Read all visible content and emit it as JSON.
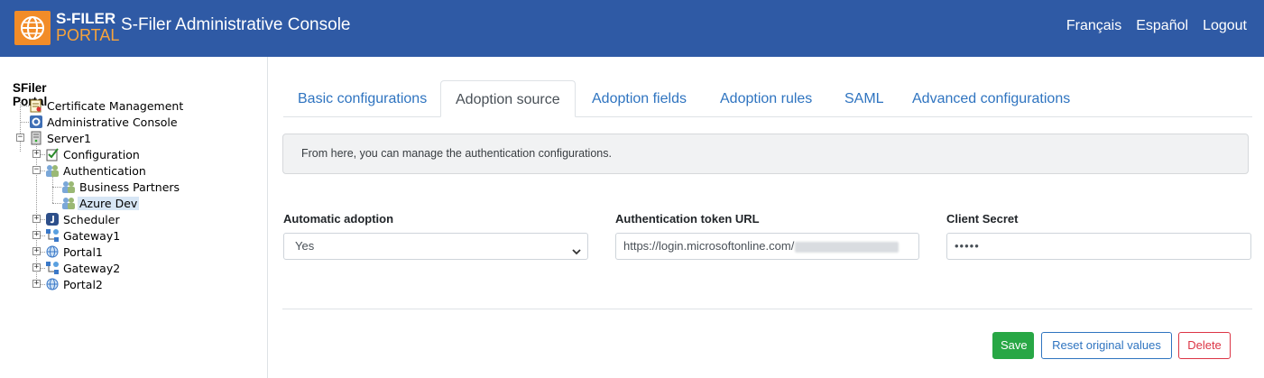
{
  "header": {
    "logo_line1": "S-FILER",
    "logo_line2": "PORTAL",
    "title": "S-Filer Administrative Console",
    "links": [
      "Français",
      "Español",
      "Logout"
    ]
  },
  "tree": {
    "root": "SFiler Portal",
    "certificate_management": "Certificate Management",
    "administrative_console": "Administrative Console",
    "server1": "Server1",
    "configuration": "Configuration",
    "authentication": "Authentication",
    "business_partners": "Business Partners",
    "azure_dev": "Azure Dev",
    "scheduler": "Scheduler",
    "gateway1": "Gateway1",
    "portal1": "Portal1",
    "gateway2": "Gateway2",
    "portal2": "Portal2"
  },
  "tabs": [
    "Basic configurations",
    "Adoption source",
    "Adoption fields",
    "Adoption rules",
    "SAML",
    "Advanced configurations"
  ],
  "active_tab": "Adoption source",
  "info_text": "From here, you can manage the authentication configurations.",
  "form": {
    "automatic_adoption_label": "Automatic adoption",
    "automatic_adoption_value": "Yes",
    "token_url_label": "Authentication token URL",
    "token_url_value": "https://login.microsoftonline.com/",
    "client_secret_label": "Client Secret",
    "client_secret_value": "•••••"
  },
  "buttons": {
    "save": "Save",
    "reset": "Reset original values",
    "delete": "Delete"
  },
  "colors": {
    "header_bg": "#2f5aa5",
    "logo_orange": "#f28c28",
    "link_blue": "#2f74c0",
    "save_green": "#28a745",
    "delete_red": "#dc3545"
  }
}
